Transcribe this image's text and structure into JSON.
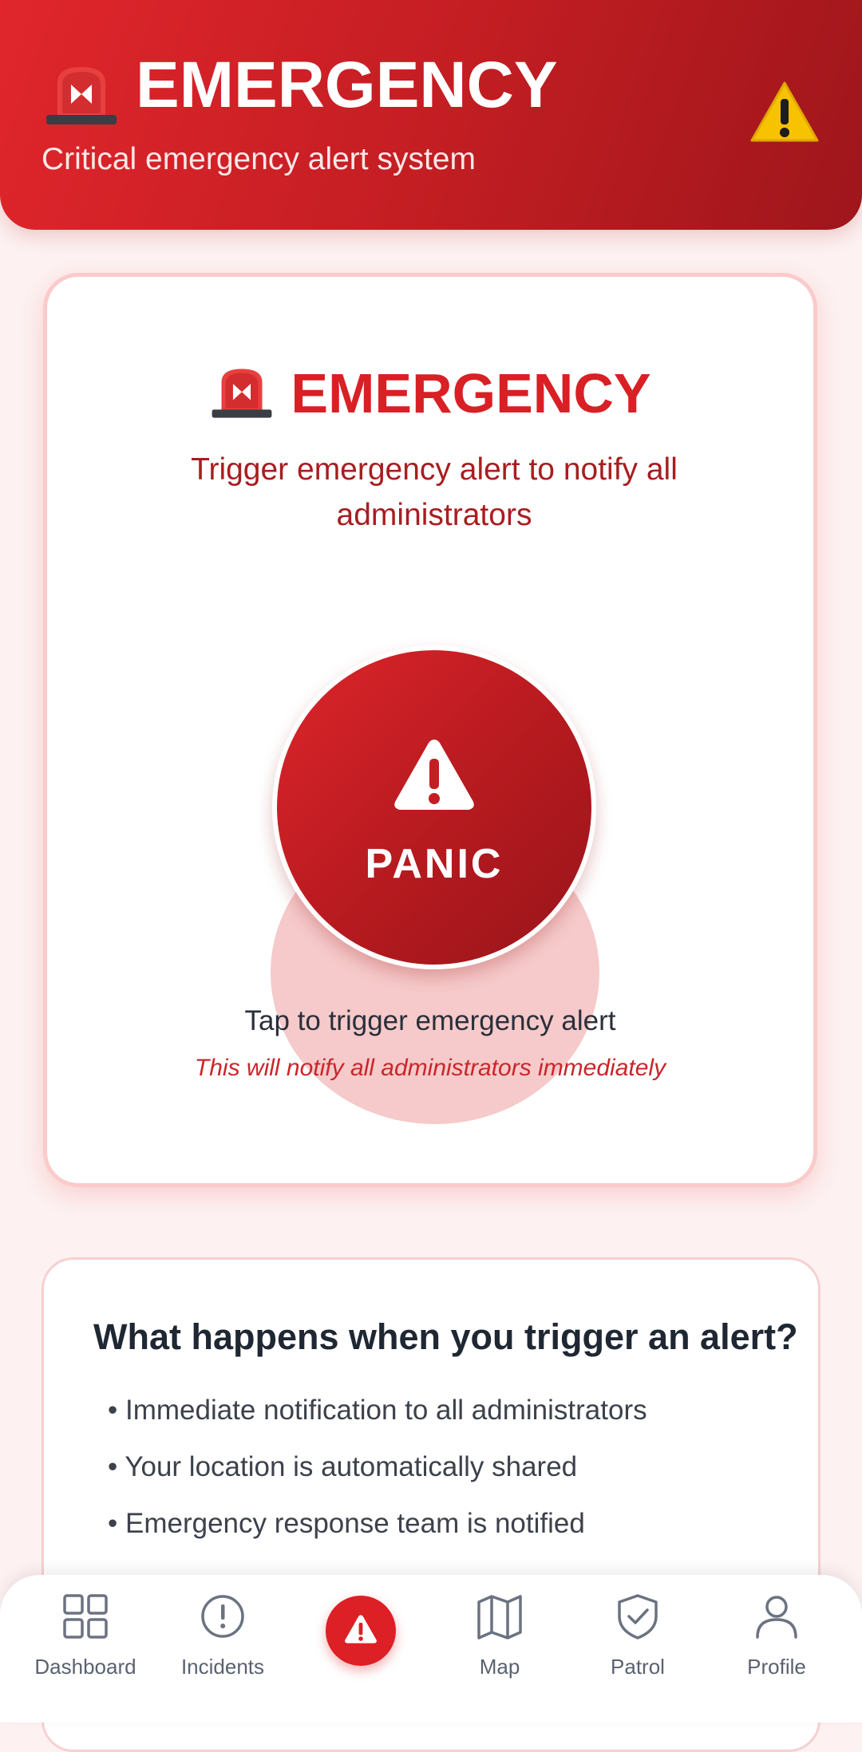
{
  "header": {
    "title": "EMERGENCY",
    "subtitle": "Critical emergency alert system",
    "icons": [
      "siren-icon",
      "warning-icon"
    ]
  },
  "panic_card": {
    "title": "EMERGENCY",
    "description": "Trigger emergency alert to notify all administrators",
    "button_label": "PANIC",
    "tap_text": "Tap to trigger emergency alert",
    "notify_text": "This will notify all administrators immediately"
  },
  "info_card": {
    "title": "What happens when you trigger an alert?",
    "items": [
      "• Immediate notification to all administrators",
      "• Your location is automatically shared",
      "• Emergency response team is notified"
    ]
  },
  "nav": {
    "items": [
      {
        "label": "Dashboard",
        "icon": "grid-icon"
      },
      {
        "label": "Incidents",
        "icon": "alert-circle-icon"
      },
      {
        "label": "",
        "icon": "warning-icon"
      },
      {
        "label": "Map",
        "icon": "map-icon"
      },
      {
        "label": "Patrol",
        "icon": "shield-check-icon"
      },
      {
        "label": "Profile",
        "icon": "user-icon"
      }
    ]
  },
  "colors": {
    "accent": "#d82025",
    "header_start": "#e0262c",
    "header_end": "#9e161b",
    "background": "#fdf1f1"
  }
}
